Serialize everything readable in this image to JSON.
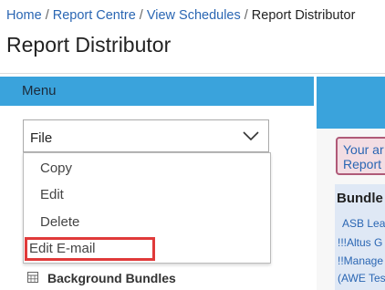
{
  "breadcrumb": {
    "items": [
      "Home",
      "Report Centre",
      "View Schedules"
    ],
    "current": "Report Distributor",
    "separator": "/"
  },
  "page": {
    "title": "Report Distributor"
  },
  "menu": {
    "title": "Menu",
    "file_select": {
      "value": "File"
    },
    "dropdown_items": [
      "Copy",
      "Edit",
      "Delete",
      "Edit E-mail"
    ],
    "highlighted_item": "Edit E-mail",
    "background_bundles": "Background Bundles"
  },
  "right_panel": {
    "notice": {
      "line1": "Your ar",
      "line2": "Report"
    },
    "bundle": {
      "header": "Bundle",
      "rows": [
        "ASB Lea",
        "!!!Altus G",
        "!!Manage",
        "(AWE Tes"
      ]
    }
  },
  "colors": {
    "accent": "#3aa3dc",
    "link": "#2a66b3",
    "highlight_border": "#e03a3a",
    "notice_bg": "#f3dde3",
    "bundle_bg": "#dfe8f5"
  }
}
